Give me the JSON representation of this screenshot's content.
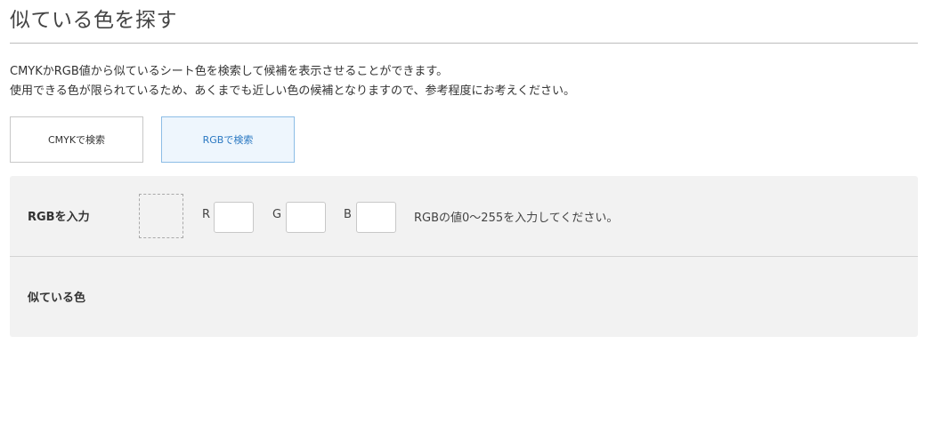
{
  "header": {
    "title": "似ている色を探す"
  },
  "description": {
    "line1": "CMYKかRGB値から似ているシート色を検索して候補を表示させることができます。",
    "line2": "使用できる色が限られているため、あくまでも近しい色の候補となりますので、参考程度にお考えください。"
  },
  "tabs": {
    "cmyk_label": "CMYKで検索",
    "rgb_label": "RGBで検索",
    "active": "rgb"
  },
  "rgb_form": {
    "row_label": "RGBを入力",
    "r_label": "R",
    "g_label": "G",
    "b_label": "B",
    "r_value": "",
    "g_value": "",
    "b_value": "",
    "hint": "RGBの値0〜255を入力してください。"
  },
  "results": {
    "row_label": "似ている色"
  },
  "colors": {
    "active_tab_bg": "#eef6fd",
    "active_tab_border": "#8cbde6",
    "active_tab_text": "#2a78c2",
    "panel_bg": "#f2f2f2"
  }
}
